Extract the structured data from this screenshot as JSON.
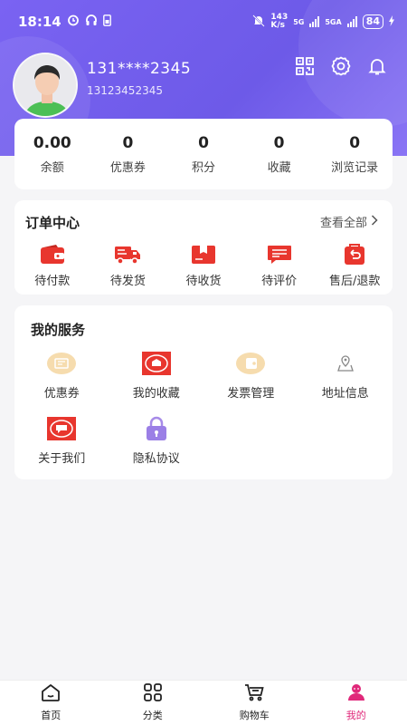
{
  "status_bar": {
    "time": "18:14",
    "net_speed_top": "143",
    "net_speed_unit": "K/s",
    "network_1": "5G",
    "network_2": "5GA",
    "battery": "84"
  },
  "profile": {
    "username": "131****2345",
    "phone": "13123452345"
  },
  "stats": [
    {
      "value": "0.00",
      "label": "余额"
    },
    {
      "value": "0",
      "label": "优惠券"
    },
    {
      "value": "0",
      "label": "积分"
    },
    {
      "value": "0",
      "label": "收藏"
    },
    {
      "value": "0",
      "label": "浏览记录"
    }
  ],
  "orders": {
    "title": "订单中心",
    "view_all": "查看全部",
    "items": [
      {
        "label": "待付款",
        "icon": "wallet-icon"
      },
      {
        "label": "待发货",
        "icon": "truck-icon"
      },
      {
        "label": "待收货",
        "icon": "box-icon"
      },
      {
        "label": "待评价",
        "icon": "comment-icon"
      },
      {
        "label": "售后/退款",
        "icon": "refund-icon"
      }
    ]
  },
  "services": {
    "title": "我的服务",
    "items": [
      {
        "label": "优惠券",
        "icon": "coupon-icon"
      },
      {
        "label": "我的收藏",
        "icon": "favorite-icon"
      },
      {
        "label": "发票管理",
        "icon": "invoice-icon"
      },
      {
        "label": "地址信息",
        "icon": "location-icon"
      },
      {
        "label": "关于我们",
        "icon": "about-icon"
      },
      {
        "label": "隐私协议",
        "icon": "lock-icon"
      }
    ]
  },
  "bottom_nav": [
    {
      "label": "首页",
      "icon": "home-icon"
    },
    {
      "label": "分类",
      "icon": "category-icon"
    },
    {
      "label": "购物车",
      "icon": "cart-icon"
    },
    {
      "label": "我的",
      "icon": "profile-icon",
      "active": true
    }
  ],
  "colors": {
    "header": "#7a63f2",
    "accent_red": "#e8362e",
    "active_nav": "#e0287a"
  }
}
